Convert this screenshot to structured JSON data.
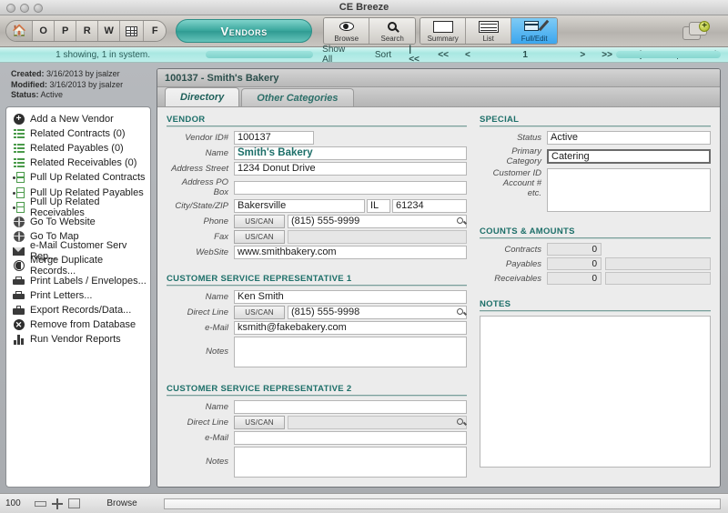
{
  "window": {
    "title": "CE Breeze"
  },
  "toolbar": {
    "quick_buttons": [
      {
        "name": "home",
        "label": "",
        "icon": "home-icon"
      },
      {
        "name": "o",
        "label": "O",
        "icon": ""
      },
      {
        "name": "p",
        "label": "P",
        "icon": ""
      },
      {
        "name": "r",
        "label": "R",
        "icon": ""
      },
      {
        "name": "w",
        "label": "W",
        "icon": ""
      },
      {
        "name": "grid",
        "label": "",
        "icon": "grid-icon"
      },
      {
        "name": "f",
        "label": "F",
        "icon": ""
      }
    ],
    "module_label": "Vendors",
    "view_buttons": [
      {
        "label": "Browse",
        "icon": "eye-icon",
        "active": false
      },
      {
        "label": "Search",
        "icon": "magnifier-icon",
        "active": false
      }
    ],
    "layout_buttons": [
      {
        "label": "Summary",
        "icon": "summary-icon",
        "active": false
      },
      {
        "label": "List",
        "icon": "list-icon",
        "active": false
      },
      {
        "label": "Full/Edit",
        "icon": "edit-icon",
        "active": true
      }
    ],
    "new_window_icon": "new-layer-icon"
  },
  "navstrip": {
    "showing": "1 showing, 1 in system.",
    "show_all": "Show All",
    "sort": "Sort",
    "first": "|<<",
    "prev_page": "<<",
    "prev": "<",
    "page": "1",
    "next": ">",
    "next_page": ">>",
    "last": ">>|",
    "jump": "Jump",
    "omit": "Omit"
  },
  "sidebar": {
    "meta": {
      "created_label": "Created:",
      "created_value": "3/16/2013 by jsalzer",
      "modified_label": "Modified:",
      "modified_value": "3/16/2013 by jsalzer",
      "status_label": "Status:",
      "status_value": "Active"
    },
    "items": [
      {
        "label": "Add a New Vendor",
        "icon": "plus-circle-icon"
      },
      {
        "label": "Related Contracts (0)",
        "icon": "list-icon"
      },
      {
        "label": "Related Payables (0)",
        "icon": "list-icon"
      },
      {
        "label": "Related Receivables (0)",
        "icon": "list-icon"
      },
      {
        "label": "Pull Up Related Contracts",
        "icon": "pull-up-icon"
      },
      {
        "label": "Pull Up Related Payables",
        "icon": "pull-up-icon"
      },
      {
        "label": "Pull Up Related Receivables",
        "icon": "pull-up-icon"
      },
      {
        "label": "Go To Website",
        "icon": "globe-icon"
      },
      {
        "label": "Go To Map",
        "icon": "globe-icon"
      },
      {
        "label": "e-Mail Customer Serv Rep...",
        "icon": "mail-icon"
      },
      {
        "label": "Merge Duplicate Records...",
        "icon": "merge-icon"
      },
      {
        "label": "Print Labels / Envelopes...",
        "icon": "printer-icon"
      },
      {
        "label": "Print Letters...",
        "icon": "printer-icon"
      },
      {
        "label": "Export Records/Data...",
        "icon": "export-icon"
      },
      {
        "label": "Remove from Database",
        "icon": "x-circle-icon"
      },
      {
        "label": "Run Vendor Reports",
        "icon": "chart-icon"
      }
    ]
  },
  "record": {
    "header": "100137 - Smith's Bakery",
    "tabs": [
      {
        "label": "Directory",
        "active": true
      },
      {
        "label": "Other Categories",
        "active": false
      }
    ]
  },
  "vendor": {
    "section_title": "VENDOR",
    "fields": {
      "vendor_id_label": "Vendor ID#",
      "vendor_id_value": "100137",
      "name_label": "Name",
      "name_value": "Smith's Bakery",
      "address_street_label": "Address Street",
      "address_street_value": "1234 Donut Drive",
      "address_pobox_label": "Address PO Box",
      "address_pobox_value": "",
      "city_state_zip_label": "City/State/ZIP",
      "city_value": "Bakersville",
      "state_value": "IL",
      "zip_value": "61234",
      "phone_label": "Phone",
      "phone_btn": "US/CAN",
      "phone_value": "(815) 555-9999",
      "fax_label": "Fax",
      "fax_btn": "US/CAN",
      "fax_value": "",
      "website_label": "WebSite",
      "website_value": "www.smithbakery.com"
    }
  },
  "csr1": {
    "section_title": "CUSTOMER SERVICE REPRESENTATIVE 1",
    "name_label": "Name",
    "name_value": "Ken Smith",
    "direct_line_label": "Direct Line",
    "direct_line_btn": "US/CAN",
    "direct_line_value": "(815) 555-9998",
    "email_label": "e-Mail",
    "email_value": "ksmith@fakebakery.com",
    "notes_label": "Notes",
    "notes_value": ""
  },
  "csr2": {
    "section_title": "CUSTOMER SERVICE REPRESENTATIVE 2",
    "name_label": "Name",
    "name_value": "",
    "direct_line_label": "Direct Line",
    "direct_line_btn": "US/CAN",
    "direct_line_value": "",
    "email_label": "e-Mail",
    "email_value": "",
    "notes_label": "Notes",
    "notes_value": ""
  },
  "special": {
    "section_title": "SPECIAL",
    "status_label": "Status",
    "status_value": "Active",
    "primary_category_label": "Primary Category",
    "primary_category_value": "Catering",
    "customer_id_label_1": "Customer ID",
    "customer_id_label_2": "Account #",
    "customer_id_label_3": "etc.",
    "customer_id_value": ""
  },
  "counts": {
    "section_title": "COUNTS & AMOUNTS",
    "rows": [
      {
        "label": "Contracts",
        "count": "0",
        "amount": ""
      },
      {
        "label": "Payables",
        "count": "0",
        "amount": ""
      },
      {
        "label": "Receivables",
        "count": "0",
        "amount": ""
      }
    ]
  },
  "notes": {
    "section_title": "NOTES",
    "value": ""
  },
  "statusbar": {
    "zoom": "100",
    "mode": "Browse"
  },
  "colors": {
    "accent_teal": "#1d6f69",
    "module_pill": "#3aa79d",
    "active_blue": "#3ba6ee",
    "nav_strip": "#a9e8e2"
  }
}
